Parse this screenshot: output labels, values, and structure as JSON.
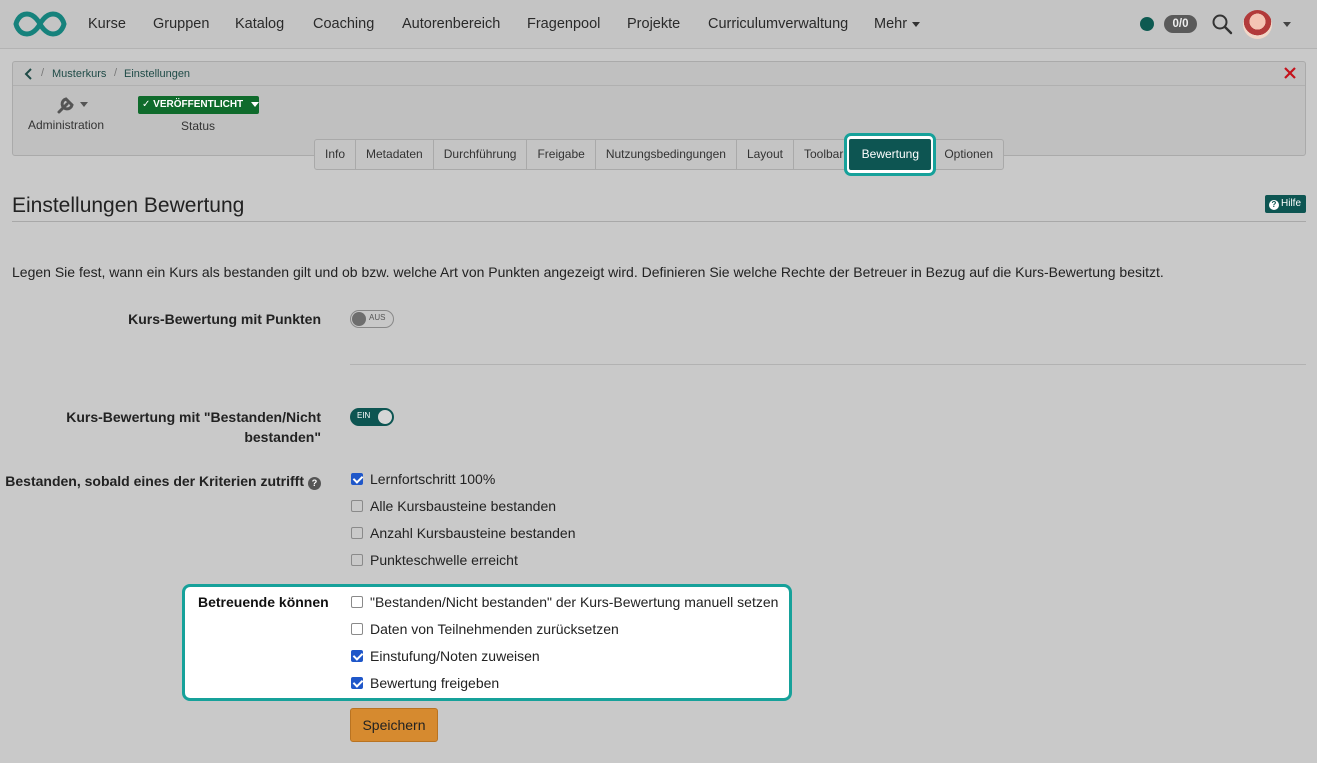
{
  "topnav": {
    "items": [
      "Kurse",
      "Gruppen",
      "Katalog",
      "Coaching",
      "Autorenbereich",
      "Fragenpool",
      "Projekte",
      "Curriculumverwaltung",
      "Mehr"
    ],
    "score": "0/0",
    "colors": {
      "status_dot": "#0d5a51",
      "brand": "#0d5552"
    }
  },
  "breadcrumb": {
    "items": [
      "Musterkurs",
      "Einstellungen"
    ],
    "separator": "/"
  },
  "toolbar": {
    "admin_label": "Administration",
    "status_badge": "VERÖFFENTLICHT",
    "status_label": "Status",
    "status_color": "#0f6b2c"
  },
  "tabs": [
    "Info",
    "Metadaten",
    "Durchführung",
    "Freigabe",
    "Nutzungsbedingungen",
    "Layout",
    "Toolbar",
    "Bewertung",
    "Optionen"
  ],
  "active_tab": "Bewertung",
  "page": {
    "title": "Einstellungen Bewertung",
    "help": "Hilfe",
    "intro": "Legen Sie fest, wann ein Kurs als bestanden gilt und ob bzw. welche Art von Punkten angezeigt wird. Definieren Sie welche Rechte der Betreuer in Bezug auf die Kurs-Bewertung besitzt."
  },
  "form": {
    "points_label": "Kurs-Bewertung mit Punkten",
    "points_toggle": "AUS",
    "passed_label_line1": "Kurs-Bewertung mit \"Bestanden/Nicht",
    "passed_label_line2": "bestanden\"",
    "passed_toggle": "EIN",
    "criteria_label": "Bestanden, sobald eines der Kriterien zutrifft",
    "criteria": [
      {
        "label": "Lernfortschritt 100%",
        "checked": true
      },
      {
        "label": "Alle Kursbausteine bestanden",
        "checked": false
      },
      {
        "label": "Anzahl Kursbausteine bestanden",
        "checked": false
      },
      {
        "label": "Punkteschwelle erreicht",
        "checked": false
      }
    ],
    "coach_label": "Betreuende können",
    "coach_rights": [
      {
        "label": "\"Bestanden/Nicht bestanden\" der Kurs-Bewertung manuell setzen",
        "checked": false
      },
      {
        "label": "Daten von Teilnehmenden zurücksetzen",
        "checked": false
      },
      {
        "label": "Einstufung/Noten zuweisen",
        "checked": true
      },
      {
        "label": "Bewertung freigeben",
        "checked": true
      }
    ],
    "save": "Speichern",
    "highlight_color": "#16a19a",
    "save_color": "#d68a2f"
  }
}
